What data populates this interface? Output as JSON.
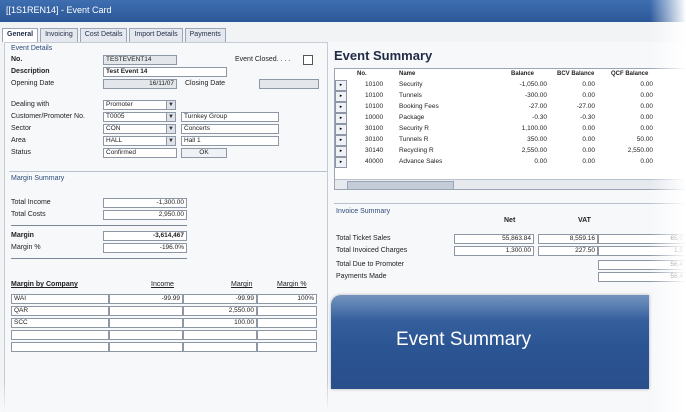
{
  "window": {
    "title": "[[1S1REN14] - Event Card"
  },
  "tabs": [
    "General",
    "Invoicing",
    "Cost Details",
    "Import Details",
    "Payments"
  ],
  "event_details": {
    "group": "Event Details",
    "no_label": "No.",
    "no_value": "TESTEVENT14",
    "closed_label": "Event Closed. . . .",
    "description_label": "Description",
    "description_value": "Test Event 14",
    "opening_label": "Opening Date",
    "opening_value": "16/11/07",
    "closing_label": "Closing Date",
    "dealing_label": "Dealing with",
    "dealing_value": "Promoter",
    "customer_label": "Customer/Promoter No.",
    "customer_value": "T0005",
    "customer_name": "Turnkey Group",
    "sector_label": "Sector",
    "sector_value": "CON",
    "sector_name": "Concerts",
    "area_label": "Area",
    "area_value": "HALL",
    "area_name": "Hall 1",
    "status_label": "Status",
    "status_value": "Confirmed",
    "status_button": "OK"
  },
  "margin_summary": {
    "group": "Margin Summary",
    "total_income_label": "Total Income",
    "total_income_value": "-1,300.00",
    "total_costs_label": "Total Costs",
    "total_costs_value": "2,950.00",
    "margin_label": "Margin",
    "margin_value": "-3,614,467",
    "margin_pct_label": "Margin %",
    "margin_pct_value": "-196.0%"
  },
  "margin_by_company": {
    "headers": [
      "Margin by Company",
      "Income",
      "Margin",
      "Margin %"
    ],
    "rows": [
      {
        "company": "WAI",
        "income": "-99.99",
        "margin": "-99.99",
        "pct": "100%"
      },
      {
        "company": "QAR",
        "income": "",
        "margin": "2,550.00",
        "pct": ""
      },
      {
        "company": "SCC",
        "income": "",
        "margin": "100.00",
        "pct": ""
      }
    ]
  },
  "event_summary": {
    "title": "Event Summary",
    "headers": [
      "No.",
      "Name",
      "Balance",
      "BCV Balance",
      "QCF Balance"
    ],
    "rows": [
      {
        "no": "10100",
        "name": "Security",
        "balance": "-1,050.00",
        "bcv": "0.00",
        "qcf": "0.00"
      },
      {
        "no": "10100",
        "name": "Tunnels",
        "balance": "-300.00",
        "bcv": "0.00",
        "qcf": "0.00"
      },
      {
        "no": "10100",
        "name": "Booking Fees",
        "balance": "-27.00",
        "bcv": "-27.00",
        "qcf": "0.00"
      },
      {
        "no": "10000",
        "name": "Package",
        "balance": "-0.30",
        "bcv": "-0.30",
        "qcf": "0.00"
      },
      {
        "no": "30100",
        "name": "Security R",
        "balance": "1,100.00",
        "bcv": "0.00",
        "qcf": "0.00"
      },
      {
        "no": "30100",
        "name": "Tunnels R",
        "balance": "350.00",
        "bcv": "0.00",
        "qcf": "50.00"
      },
      {
        "no": "30140",
        "name": "Recycling R",
        "balance": "2,550.00",
        "bcv": "0.00",
        "qcf": "2,550.00"
      },
      {
        "no": "40000",
        "name": "Advance Sales",
        "balance": "0.00",
        "bcv": "0.00",
        "qcf": "0.00"
      }
    ]
  },
  "invoice_summary": {
    "group": "Invoice Summary",
    "headers": [
      "Net",
      "VAT"
    ],
    "rows": [
      {
        "label": "Total Ticket Sales",
        "net": "55,863.84",
        "vat": "8,559.16",
        "extra": "65,0"
      },
      {
        "label": "Total Invoiced Charges",
        "net": "1,300.00",
        "vat": "227.50",
        "extra": "1,5"
      },
      {
        "label": "Total Due to Promoter",
        "net": "",
        "vat": "",
        "extra": "56,4"
      },
      {
        "label": "Payments Made",
        "net": "",
        "vat": "",
        "extra": "56,4"
      }
    ]
  },
  "banner": {
    "text": "Event Summary"
  }
}
